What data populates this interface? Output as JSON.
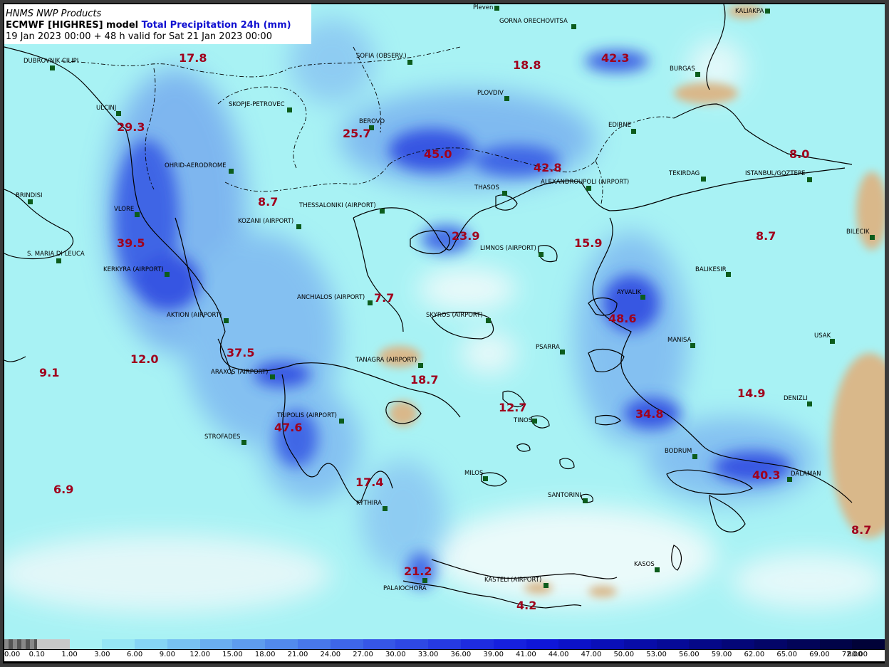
{
  "header": {
    "line1": "HNMS NWP Products",
    "line2_a": "ECMWF [HIGHRES] model ",
    "line2_b": "Total Precipitation 24h (mm)",
    "line3": "19 Jan 2023 00:00 + 48 h valid for Sat 21 Jan 2023 00:00"
  },
  "colors": {
    "sea_base": "#a8f2f4",
    "land_dry": "#d9b88a",
    "value_text": "#a0001c",
    "station_marker": "#0c5c1c"
  },
  "stations": [
    {
      "name": "Pleven",
      "id": "pleven"
    },
    {
      "name": "KALIAKPA",
      "id": "kaliakra"
    },
    {
      "name": "GORNA ORECHOVITSA",
      "id": "gorna"
    },
    {
      "name": "DUBROVNIK CILIPI",
      "id": "dubrovnik"
    },
    {
      "name": "SOFIA (OBSERV.)",
      "id": "sofia"
    },
    {
      "name": "BURGAS",
      "id": "burgas"
    },
    {
      "name": "PLOVDIV",
      "id": "plovdiv"
    },
    {
      "name": "ULCINJ",
      "id": "ulcinj"
    },
    {
      "name": "SKOPJE-PETROVEC",
      "id": "skopje"
    },
    {
      "name": "BEROVO",
      "id": "berovo"
    },
    {
      "name": "EDIRNE",
      "id": "edirne"
    },
    {
      "name": "OHRID-AERODROME",
      "id": "ohrid"
    },
    {
      "name": "TEKIRDAG",
      "id": "tekirdag"
    },
    {
      "name": "ISTANBUL/GOZTEPE",
      "id": "istanbul"
    },
    {
      "name": "THASOS",
      "id": "thasos"
    },
    {
      "name": "ALEXANDROUPOLI (AIRPORT)",
      "id": "alexandroupoli"
    },
    {
      "name": "BRINDISI",
      "id": "brindisi"
    },
    {
      "name": "THESSALONIKI (AIRPORT)",
      "id": "thessaloniki"
    },
    {
      "name": "VLORE",
      "id": "vlore"
    },
    {
      "name": "KOZANI (AIRPORT)",
      "id": "kozani"
    },
    {
      "name": "BILECIK",
      "id": "bilecik"
    },
    {
      "name": "LIMNOS (AIRPORT)",
      "id": "limnos"
    },
    {
      "name": "S. MARIA DI LEUCA",
      "id": "leuca"
    },
    {
      "name": "KERKYRA (AIRPORT)",
      "id": "kerkyra"
    },
    {
      "name": "BALIKESIR",
      "id": "balikesir"
    },
    {
      "name": "AYVALIK",
      "id": "ayvalik"
    },
    {
      "name": "ANCHIALOS (AIRPORT)",
      "id": "anchialos"
    },
    {
      "name": "SKYROS (AIRPORT)",
      "id": "skyros"
    },
    {
      "name": "AKTION (AIRPORT)",
      "id": "aktion"
    },
    {
      "name": "USAK",
      "id": "usak"
    },
    {
      "name": "MANISA",
      "id": "manisa"
    },
    {
      "name": "PSARRA",
      "id": "psarra"
    },
    {
      "name": "TANAGRA (AIRPORT)",
      "id": "tanagra"
    },
    {
      "name": "ARAXOS (AIRPORT)",
      "id": "araxos"
    },
    {
      "name": "DENIZLI",
      "id": "denizli"
    },
    {
      "name": "TRIPOLIS (AIRPORT)",
      "id": "tripolis"
    },
    {
      "name": "TINOS",
      "id": "tinos"
    },
    {
      "name": "STROFADES",
      "id": "strofades"
    },
    {
      "name": "BODRUM",
      "id": "bodrum"
    },
    {
      "name": "MILOS",
      "id": "milos"
    },
    {
      "name": "DALAMAN",
      "id": "dalaman"
    },
    {
      "name": "SANTORINI",
      "id": "santorini"
    },
    {
      "name": "KYTHIRA",
      "id": "kythira"
    },
    {
      "name": "KASOS",
      "id": "kasos"
    },
    {
      "name": "KASTELI (AIRPORT)",
      "id": "kasteli"
    },
    {
      "name": "PALAIOCHORA",
      "id": "palaiochora"
    }
  ],
  "values": [
    {
      "text": "17.8",
      "id": "v1"
    },
    {
      "text": "18.8",
      "id": "v2"
    },
    {
      "text": "42.3",
      "id": "v3"
    },
    {
      "text": "29.3",
      "id": "v4"
    },
    {
      "text": "25.7",
      "id": "v5"
    },
    {
      "text": "45.0",
      "id": "v6"
    },
    {
      "text": "42.8",
      "id": "v7"
    },
    {
      "text": "8.0",
      "id": "v8"
    },
    {
      "text": "8.7",
      "id": "v9"
    },
    {
      "text": "23.9",
      "id": "v10"
    },
    {
      "text": "15.9",
      "id": "v11"
    },
    {
      "text": "8.7",
      "id": "v12"
    },
    {
      "text": "39.5",
      "id": "v13"
    },
    {
      "text": "7.7",
      "id": "v14"
    },
    {
      "text": "48.6",
      "id": "v15"
    },
    {
      "text": "37.5",
      "id": "v16"
    },
    {
      "text": "12.0",
      "id": "v17"
    },
    {
      "text": "9.1",
      "id": "v18"
    },
    {
      "text": "18.7",
      "id": "v19"
    },
    {
      "text": "14.9",
      "id": "v20"
    },
    {
      "text": "12.7",
      "id": "v21"
    },
    {
      "text": "34.8",
      "id": "v22"
    },
    {
      "text": "47.6",
      "id": "v23"
    },
    {
      "text": "40.3",
      "id": "v24"
    },
    {
      "text": "6.9",
      "id": "v25"
    },
    {
      "text": "17.4",
      "id": "v26"
    },
    {
      "text": "8.7",
      "id": "v27"
    },
    {
      "text": "21.2",
      "id": "v28"
    },
    {
      "text": "4.2",
      "id": "v29"
    }
  ],
  "colorbar": {
    "labels": [
      "0.00",
      "0.10",
      "1.00",
      "3.00",
      "6.00",
      "9.00",
      "12.00",
      "15.00",
      "18.00",
      "21.00",
      "24.00",
      "27.00",
      "30.00",
      "33.00",
      "36.00",
      "39.00",
      "41.00",
      "44.00",
      "47.00",
      "50.00",
      "53.00",
      "56.00",
      "59.00",
      "62.00",
      "65.00",
      "69.00",
      "72.00",
      "80.00"
    ],
    "colors": [
      "#9a9a9a",
      "#c8c8c8",
      "#a8f2f4",
      "#96e6f4",
      "#86d4f4",
      "#78c2f2",
      "#6aaef0",
      "#5e9cee",
      "#528aec",
      "#4878ea",
      "#3e66e8",
      "#3656e6",
      "#2e48e4",
      "#263ae2",
      "#1e2ce0",
      "#1620de",
      "#0f16d8",
      "#0c12c8",
      "#0a0fb8",
      "#080ca8",
      "#060a98",
      "#050888",
      "#040678",
      "#030568",
      "#020458",
      "#010348",
      "#010238"
    ]
  }
}
